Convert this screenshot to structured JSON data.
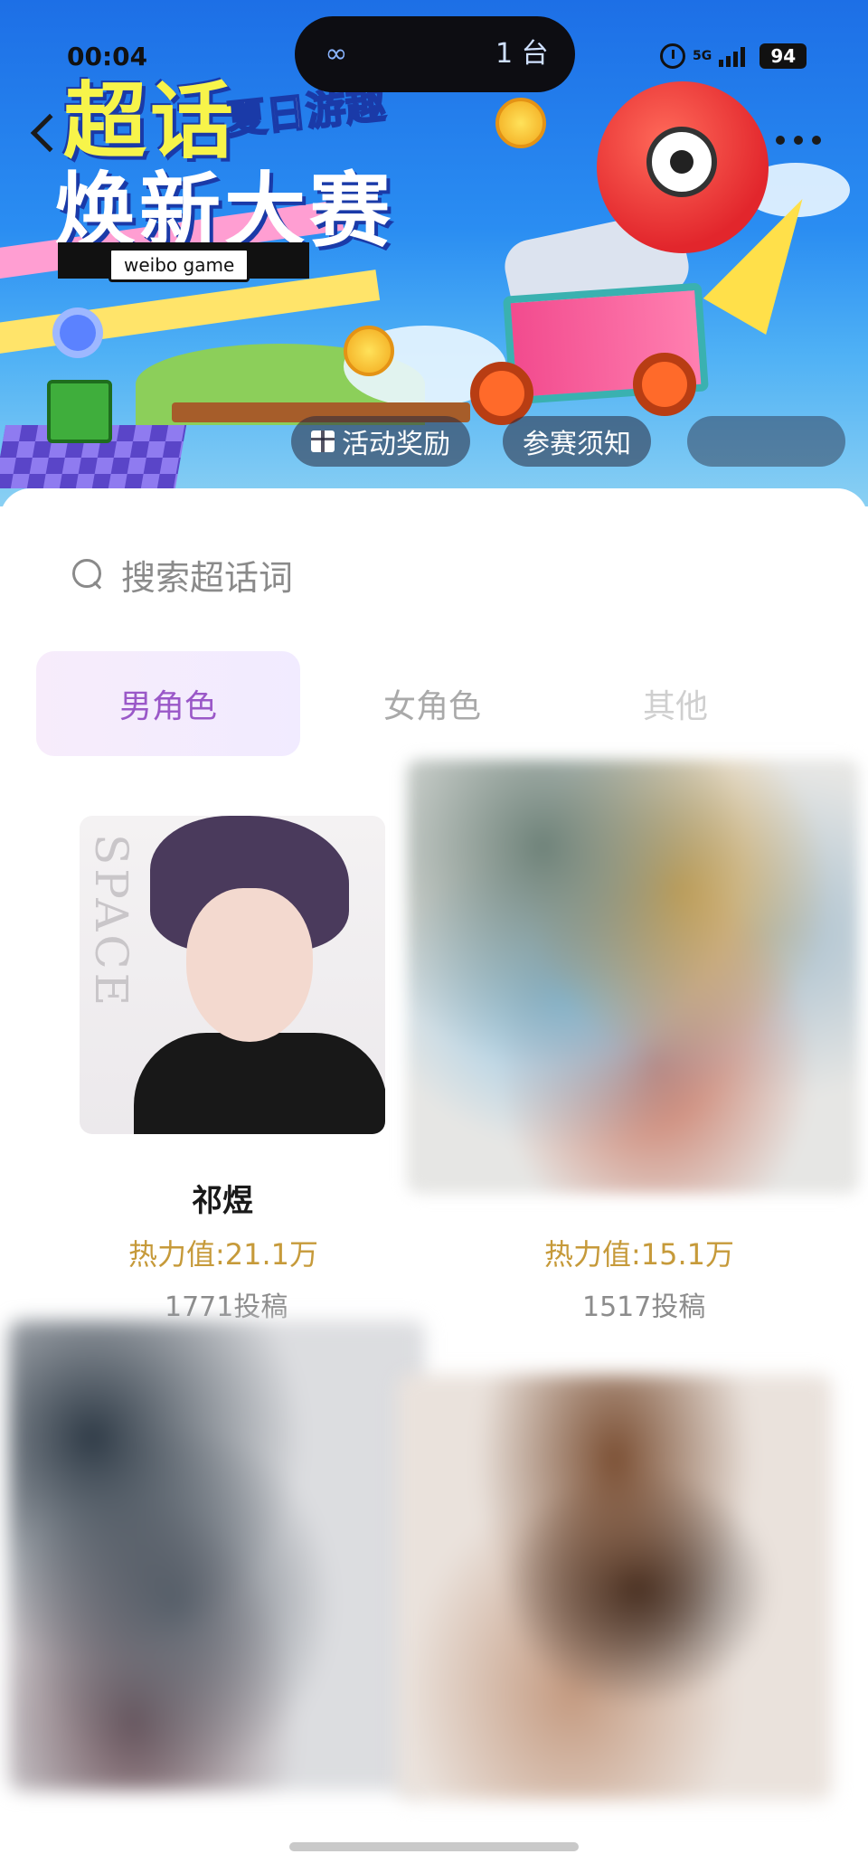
{
  "status_bar": {
    "time": "00:04",
    "island_text": "1 台",
    "network": "5G",
    "battery": "94"
  },
  "banner": {
    "title_main": "超话",
    "title_tag": "夏日游趣",
    "title_sub": "焕新大赛",
    "brand": "weibo game",
    "buttons": [
      {
        "label": "活动奖励",
        "icon": "gift-icon"
      },
      {
        "label": "参赛须知"
      }
    ]
  },
  "search": {
    "placeholder": "搜索超话词"
  },
  "tabs": [
    {
      "label": "男角色",
      "active": true
    },
    {
      "label": "女角色",
      "active": false
    },
    {
      "label": "其他",
      "active": false
    }
  ],
  "items": [
    {
      "name": "祁煜",
      "heat": "热力值:21.1万",
      "posts": "1771投稿"
    },
    {
      "name": "",
      "heat": "热力值:15.1万",
      "posts": "1517投稿"
    }
  ],
  "colors": {
    "tab_active_text": "#9a58c8",
    "heat_text": "#c69a3a",
    "banner_blue": "#2a8df2"
  }
}
